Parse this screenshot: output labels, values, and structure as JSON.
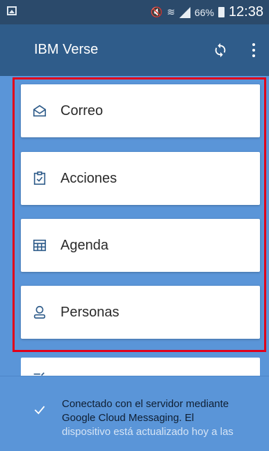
{
  "status_bar": {
    "battery": "66%",
    "time": "12:38"
  },
  "app_bar": {
    "title": "IBM Verse"
  },
  "menu": {
    "items": [
      {
        "label": "Correo",
        "icon": "envelope-open-icon"
      },
      {
        "label": "Acciones",
        "icon": "clipboard-check-icon"
      },
      {
        "label": "Agenda",
        "icon": "calendar-grid-icon"
      },
      {
        "label": "Personas",
        "icon": "person-icon"
      }
    ]
  },
  "toast": {
    "line1": "Conectado con el servidor mediante",
    "line2": "Google Cloud Messaging. El",
    "line3": "dispositivo está actualizado hoy a las"
  },
  "colors": {
    "status_bar": "#2b4a6b",
    "app_bar": "#2f5c8a",
    "background": "#5a95d8",
    "highlight": "#e2001a"
  }
}
